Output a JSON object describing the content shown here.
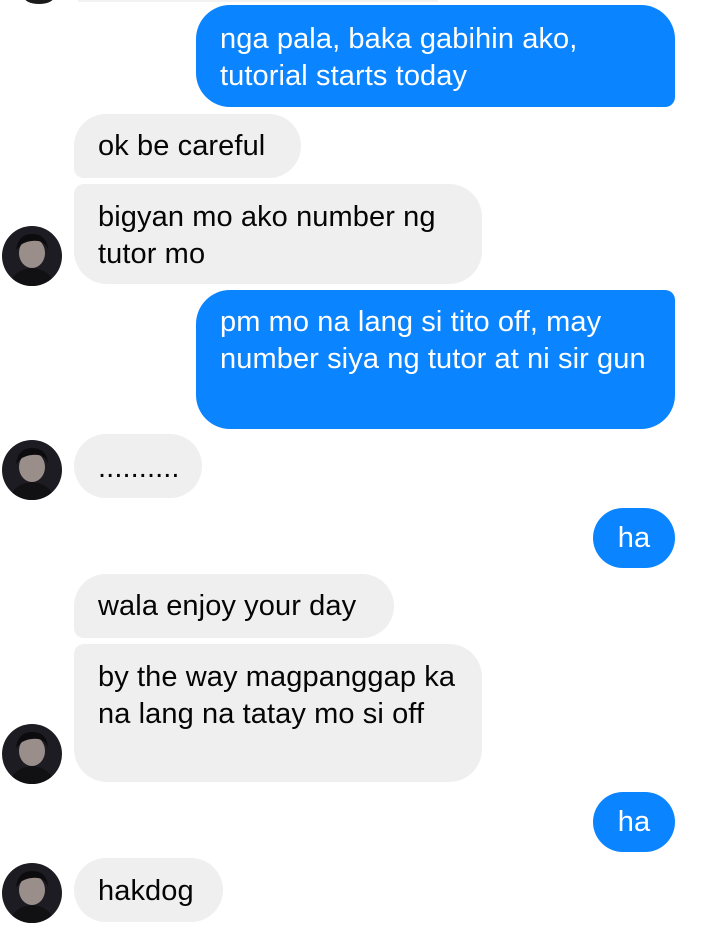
{
  "messages": [
    {
      "from": "me",
      "text": "nga pala, baka gabihin ako, tutorial starts today"
    },
    {
      "from": "other",
      "text": "ok be careful"
    },
    {
      "from": "other",
      "text": "bigyan mo ako number ng tutor mo"
    },
    {
      "from": "me",
      "text": "pm mo na lang si tito off, may number siya ng tutor at ni sir gun"
    },
    {
      "from": "other",
      "text": ".........."
    },
    {
      "from": "me",
      "text": "ha"
    },
    {
      "from": "other",
      "text": "wala enjoy your day"
    },
    {
      "from": "other",
      "text": "by the way magpanggap ka na lang na tatay mo si off"
    },
    {
      "from": "me",
      "text": "ha"
    },
    {
      "from": "other",
      "text": "hakdog"
    }
  ],
  "colors": {
    "outgoing_bubble": "#0b84ff",
    "incoming_bubble": "#efefef",
    "outgoing_text": "#ffffff",
    "incoming_text": "#050505"
  },
  "icons": {
    "avatar": "contact-avatar-icon"
  }
}
